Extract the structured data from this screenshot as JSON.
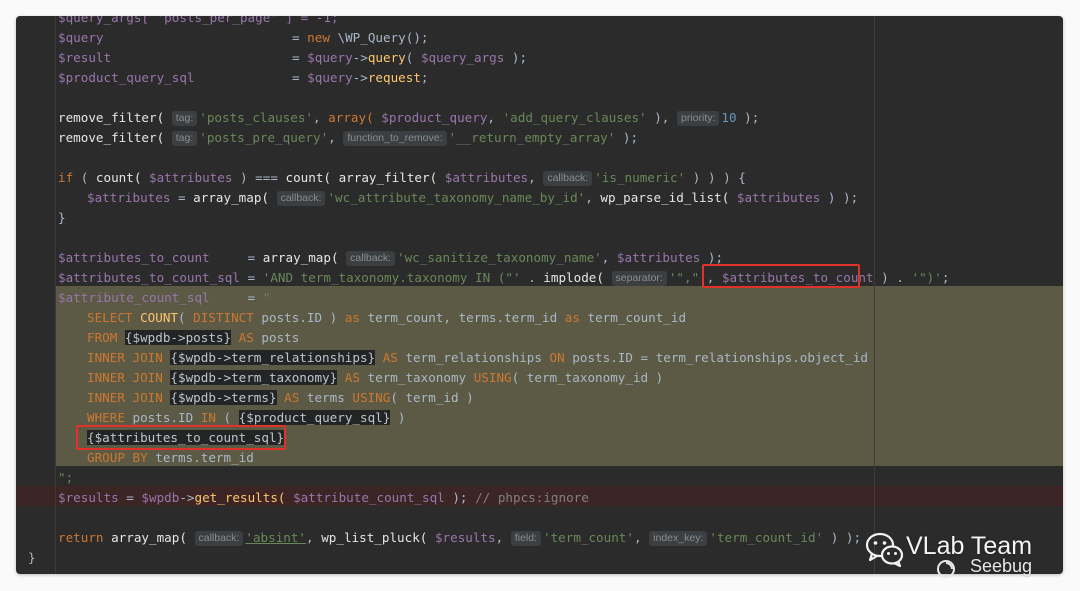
{
  "editor": {
    "lines": {
      "l0": "$query_args[ 'posts_per_page' ] = -1;",
      "l1_var": "$query",
      "l1_rest": "= new \\WP_Query();",
      "l2_var": "$result",
      "l2_a": "= ",
      "l2_b": "$query",
      "l2_c": "->",
      "l2_d": "query",
      "l2_e": "( ",
      "l2_f": "$query_args",
      "l2_g": " );",
      "l3_var": "$product_query_sql",
      "l3_a": "= ",
      "l3_b": "$query",
      "l3_c": "->",
      "l3_d": "request",
      "l3_e": ";",
      "l5_fn": "remove_filter(",
      "l5_hint1": "tag:",
      "l5_s1": "'posts_clauses'",
      "l5_c1": ", ",
      "l5_k": "array(",
      "l5_v": " $product_query",
      "l5_c2": ", ",
      "l5_s2": "'add_query_clauses'",
      "l5_c3": " ),",
      "l5_hint2": "priority:",
      "l5_n": "10",
      "l5_end": " );",
      "l6_fn": "remove_filter(",
      "l6_hint1": "tag:",
      "l6_s1": "'posts_pre_query'",
      "l6_c1": ",",
      "l6_hint2": "function_to_remove:",
      "l6_s2": "'__return_empty_array'",
      "l6_end": " );",
      "l8_k": "if",
      "l8_a": " ( ",
      "l8_fn1": "count(",
      "l8_v1": " $attributes",
      "l8_b": " ) === ",
      "l8_fn2": "count(",
      "l8_fn3": " array_filter(",
      "l8_v2": " $attributes",
      "l8_c": ",",
      "l8_hint": "callback:",
      "l8_s": "'is_numeric'",
      "l8_end": " ) ) ) {",
      "l9_v": "$attributes",
      "l9_a": " = ",
      "l9_fn": "array_map(",
      "l9_hint": "callback:",
      "l9_s": "'wc_attribute_taxonomy_name_by_id'",
      "l9_b": ", ",
      "l9_fn2": "wp_parse_id_list(",
      "l9_v2": " $attributes",
      "l9_end": " ) );",
      "l10": "}",
      "l12_v": "$attributes_to_count",
      "l12_a": "     = ",
      "l12_fn": "array_map(",
      "l12_hint": "callback:",
      "l12_s": "'wc_sanitize_taxonomy_name'",
      "l12_b": ", ",
      "l12_v2": "$attributes",
      "l12_end": " );",
      "l13_v": "$attributes_to_count_sql",
      "l13_a": " = ",
      "l13_s1": "'AND term_taxonomy.taxonomy IN (\"'",
      "l13_b": " . ",
      "l13_fn": "implode(",
      "l13_hint": "separator:",
      "l13_s2": "'\",\"'",
      "l13_c": ", ",
      "l13_v2": "$attributes_to_count",
      "l13_d": " ) . ",
      "l13_s3": "'\")'",
      "l13_end": ";",
      "l14_v": "$attribute_count_sql",
      "l14_a": "     = ",
      "l14_s": "\"",
      "l15_k1": "SELECT ",
      "l15_fn": "COUNT",
      "l15_a": "( ",
      "l15_k2": "DISTINCT",
      "l15_b": " posts.ID ) ",
      "l15_k3": "as",
      "l15_c": " term_count, terms.term_id ",
      "l15_k4": "as",
      "l15_d": " term_count_id",
      "l16_k": "FROM ",
      "l16_i": "{$wpdb->posts}",
      "l16_k2": " AS",
      "l16_rest": " posts",
      "l17_k": "INNER JOIN ",
      "l17_i": "{$wpdb->term_relationships}",
      "l17_k2": " AS",
      "l17_a": " term_relationships ",
      "l17_k3": "ON",
      "l17_b": " posts.ID = term_relationships.object_id",
      "l18_k": "INNER JOIN ",
      "l18_i": "{$wpdb->term_taxonomy}",
      "l18_k2": " AS",
      "l18_a": " term_taxonomy ",
      "l18_k3": "USING",
      "l18_b": "( term_taxonomy_id )",
      "l19_k": "INNER JOIN ",
      "l19_i": "{$wpdb->terms}",
      "l19_k2": " AS",
      "l19_a": " terms ",
      "l19_k3": "USING",
      "l19_b": "( term_id )",
      "l20_k": "WHERE",
      "l20_a": " posts.ID ",
      "l20_k2": "IN",
      "l20_b": " ( ",
      "l20_i": "{$product_query_sql}",
      "l20_c": " )",
      "l21_i": "{$attributes_to_count_sql}",
      "l22_k": "GROUP BY",
      "l22_a": " terms.term_id",
      "l23": "\";",
      "l24_v": "$results",
      "l24_a": " = ",
      "l24_v2": "$wpdb",
      "l24_b": "->",
      "l24_f": "get_results(",
      "l24_v3": " $attribute_count_sql",
      "l24_c": " ); ",
      "l24_cm": "// phpcs:ignore",
      "l26_k": "return",
      "l26_fn": " array_map(",
      "l26_hint1": "callback:",
      "l26_s1": "'absint'",
      "l26_a": ", ",
      "l26_fn2": "wp_list_pluck(",
      "l26_v": " $results",
      "l26_b": ",",
      "l26_hint2": "field:",
      "l26_s2": "'term_count'",
      "l26_c": ",",
      "l26_hint3": "index_key:",
      "l26_s3": "'term_count_id'",
      "l26_end": " ) );",
      "l27": "}"
    }
  },
  "watermark": {
    "title": "VLab Team",
    "subtitle": "Seebug",
    "icon": "wechat-icon"
  },
  "colors": {
    "background": "#2b2b2b",
    "highlight": "#5c5a45",
    "annotation_box": "#e0312a"
  }
}
